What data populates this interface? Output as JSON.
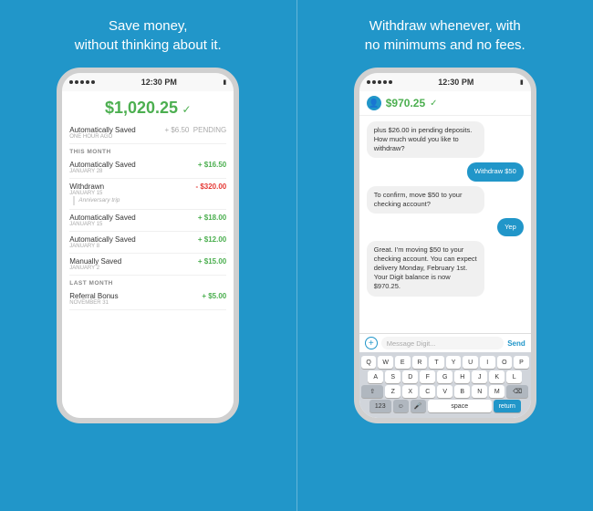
{
  "left_panel": {
    "headline": "Save money,\nwithout thinking about it.",
    "phone": {
      "status_bar": {
        "dots": [
          "•",
          "•",
          "•",
          "•",
          "•"
        ],
        "time": "12:30 PM",
        "battery": "▮"
      },
      "balance": "$1,020.25",
      "transactions": [
        {
          "label": "Automatically Saved",
          "date": "ONE HOUR AGO",
          "amount": "+ $6.50",
          "type": "pending",
          "note": "PENDING"
        }
      ],
      "section_this_month": "THIS MONTH",
      "this_month_items": [
        {
          "label": "Automatically Saved",
          "date": "JANUARY 28",
          "amount": "+ $16.50",
          "type": "green"
        },
        {
          "label": "Withdrawn",
          "date": "JANUARY 15",
          "amount": "- $320.00",
          "type": "red",
          "note": "Anniversary trip"
        },
        {
          "label": "Automatically Saved",
          "date": "JANUARY 15",
          "amount": "+ $18.00",
          "type": "green"
        },
        {
          "label": "Automatically Saved",
          "date": "JANUARY 8",
          "amount": "+ $12.00",
          "type": "green"
        },
        {
          "label": "Manually Saved",
          "date": "JANUARY 2",
          "amount": "+ $15.00",
          "type": "green"
        }
      ],
      "section_last_month": "LAST MONTH",
      "last_month_items": [
        {
          "label": "Referral Bonus",
          "date": "NOVEMBER 31",
          "amount": "+ $5.00",
          "type": "green"
        }
      ]
    }
  },
  "right_panel": {
    "headline": "Withdraw whenever, with\nno minimums and no fees.",
    "phone": {
      "status_bar": {
        "time": "12:30 PM"
      },
      "balance": "$970.25",
      "messages": [
        {
          "side": "left",
          "text": "plus $26.00 in pending deposits. How much would you like to withdraw?"
        },
        {
          "side": "right",
          "text": "Withdraw $50"
        },
        {
          "side": "left",
          "text": "To confirm, move $50 to your checking account?"
        },
        {
          "side": "right",
          "text": "Yep"
        },
        {
          "side": "left",
          "text": "Great. I'm moving $50 to your checking account. You can expect delivery Monday, February 1st. Your Digit balance is now $970.25."
        }
      ],
      "chat_input_placeholder": "Message Digit...",
      "chat_send": "Send",
      "keyboard": {
        "row1": [
          "Q",
          "W",
          "E",
          "R",
          "T",
          "Y",
          "U",
          "I",
          "O",
          "P"
        ],
        "row2": [
          "A",
          "S",
          "D",
          "F",
          "G",
          "H",
          "J",
          "K",
          "L"
        ],
        "row3": [
          "Z",
          "X",
          "C",
          "V",
          "B",
          "N",
          "M"
        ],
        "row4_left": "123",
        "row4_space": "space",
        "row4_return": "return"
      }
    }
  }
}
